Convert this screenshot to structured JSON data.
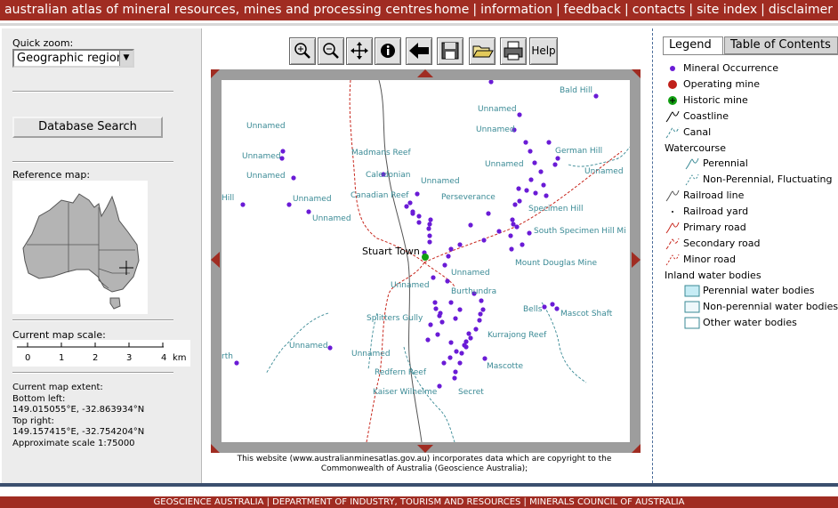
{
  "header": {
    "title": "australian atlas of mineral resources, mines and processing centres",
    "nav": [
      "home",
      "information",
      "feedback",
      "contacts",
      "site index",
      "disclaimer"
    ]
  },
  "left": {
    "quick_zoom_label": "Quick zoom:",
    "quick_zoom_value": "Geographic region",
    "database_search": "Database Search",
    "reference_map_label": "Reference map:",
    "scale_label": "Current map scale:",
    "scale_ticks": [
      "0",
      "1",
      "2",
      "3",
      "4",
      "km"
    ],
    "extent_label": "Current map extent:",
    "bottom_left_label": "Bottom left:",
    "bottom_left_value": "149.015055°E, -32.863934°N",
    "top_right_label": "Top right:",
    "top_right_value": "149.157415°E, -32.754204°N",
    "approx_scale": "Approximate scale 1:75000"
  },
  "toolbar": {
    "buttons": [
      "zoom-in",
      "zoom-out",
      "pan",
      "info",
      "back",
      "save",
      "open",
      "print",
      "Help"
    ],
    "help_label": "Help"
  },
  "map": {
    "town_label": "Stuart Town",
    "place_labels": [
      "Bald Hill",
      "Unnamed",
      "German Hill",
      "Madmans Reef",
      "Caledonian",
      "Canadian Reef",
      "Perseverance",
      "Specimen Hill",
      "South Specimen Hill Mi",
      "Mount Douglas Mine",
      "Burthundra",
      "Splitters Gully",
      "Bells",
      "Mascot Shaft",
      "Kurrajong Reef",
      "Mascotte",
      "Redfern Reef",
      "Kaiser Wilhelme",
      "Secret",
      "Hill",
      "rth"
    ],
    "copyright": "This website (www.australianminesatlas.gov.au) incorporates data which are copyright to the Commonwealth of Australia (Geoscience Australia);"
  },
  "legend": {
    "tabs": [
      "Legend",
      "Table of Contents"
    ],
    "items": [
      {
        "icon": "mineral-occurrence-dot",
        "label": "Mineral Occurrence",
        "color": "#6a1bd6"
      },
      {
        "icon": "operating-mine-dot",
        "label": "Operating mine",
        "color": "#c0201a"
      },
      {
        "icon": "historic-mine-dot",
        "label": "Historic mine",
        "color": "#12a012"
      },
      {
        "icon": "coastline-line",
        "label": "Coastline"
      },
      {
        "icon": "canal-line",
        "label": "Canal"
      },
      {
        "icon": "",
        "label": "Watercourse"
      },
      {
        "icon": "perennial-line",
        "label": "Perennial"
      },
      {
        "icon": "non-perennial-line",
        "label": "Non-Perennial, Fluctuating"
      },
      {
        "icon": "railroad-line",
        "label": "Railroad line"
      },
      {
        "icon": "railroad-yard-dot",
        "label": "Railroad yard"
      },
      {
        "icon": "primary-road-line",
        "label": "Primary road"
      },
      {
        "icon": "secondary-road-line",
        "label": "Secondary road"
      },
      {
        "icon": "minor-road-line",
        "label": "Minor road"
      },
      {
        "icon": "",
        "label": "Inland water bodies"
      },
      {
        "icon": "perennial-water-box",
        "label": "Perennial water bodies"
      },
      {
        "icon": "non-perennial-water-box",
        "label": "Non-perennial water bodies"
      },
      {
        "icon": "other-water-box",
        "label": "Other water bodies"
      }
    ]
  },
  "footer": {
    "text": "GEOSCIENCE AUSTRALIA | DEPARTMENT OF INDUSTRY, TOURISM AND RESOURCES | MINERALS COUNCIL OF AUSTRALIA"
  },
  "colors": {
    "header_bg": "#a02c22",
    "mineral_dot": "#6a1bd6",
    "label_teal": "#3a8a95",
    "road_red": "#c8281e"
  }
}
